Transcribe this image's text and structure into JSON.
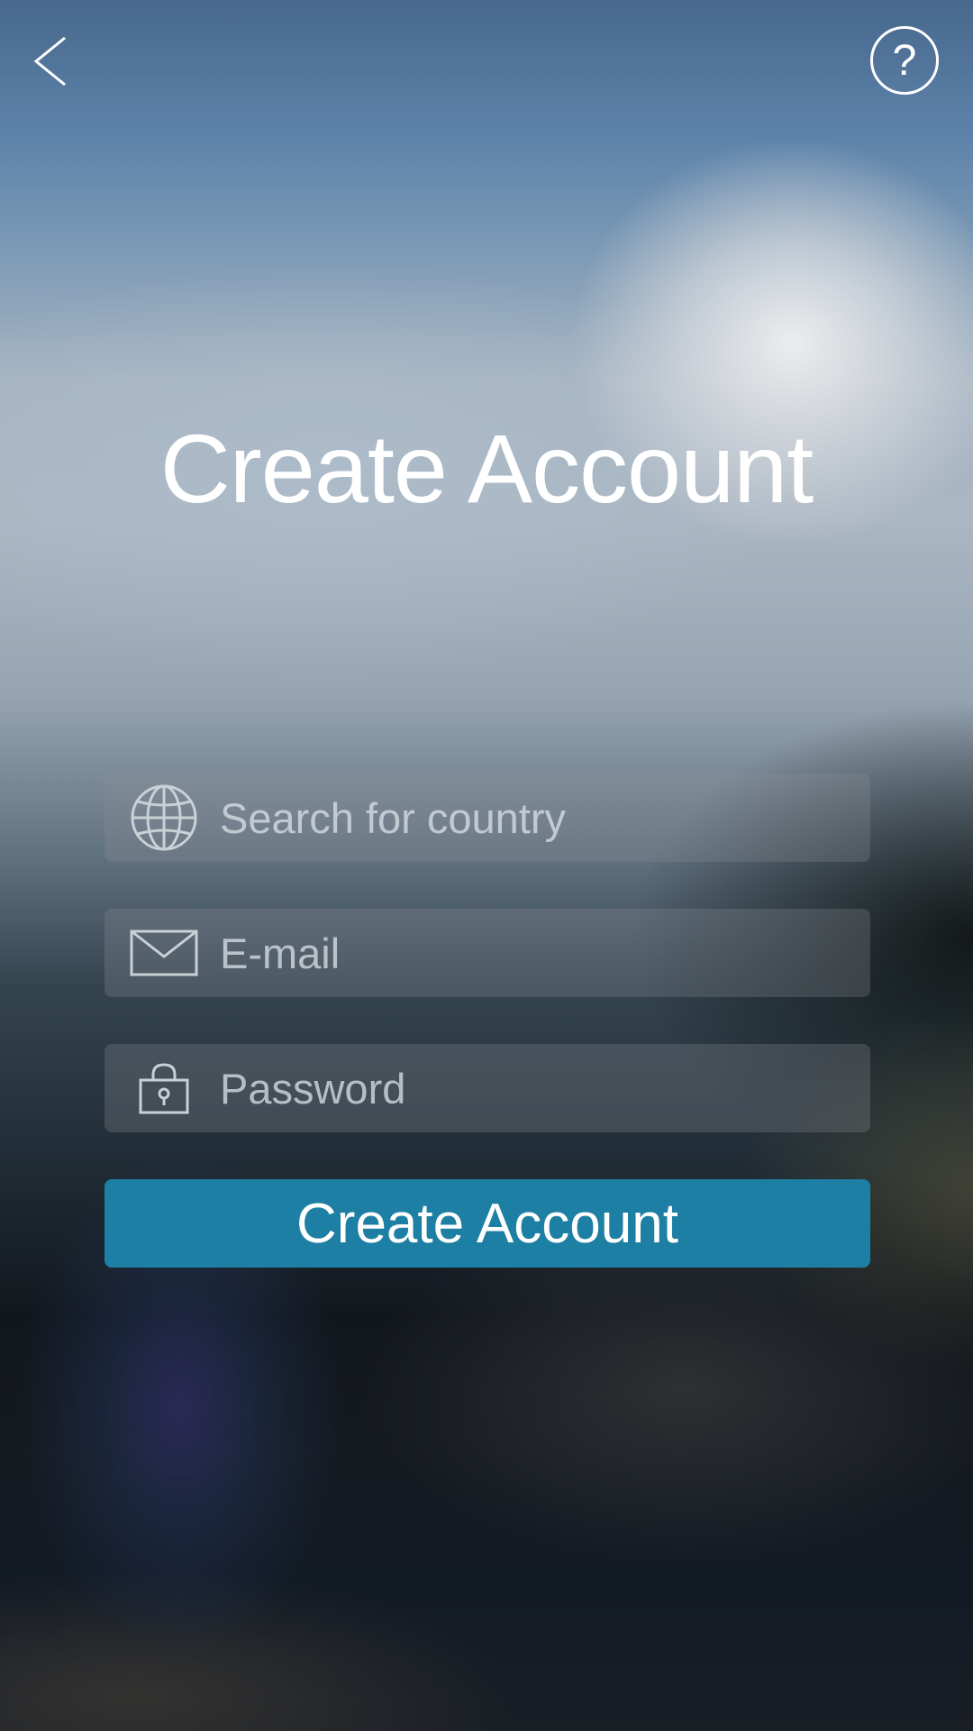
{
  "header": {
    "back_icon": "chevron-left-icon",
    "help_icon": "question-mark-icon",
    "help_label": "?"
  },
  "title": "Create Account",
  "form": {
    "country": {
      "icon": "globe-icon",
      "placeholder": "Search for country",
      "value": ""
    },
    "email": {
      "icon": "envelope-icon",
      "placeholder": "E-mail",
      "value": ""
    },
    "password": {
      "icon": "lock-icon",
      "placeholder": "Password",
      "value": ""
    },
    "submit_label": "Create Account"
  },
  "colors": {
    "accent": "#1d7fa3",
    "text": "#ffffff",
    "placeholder": "#d7dee4"
  }
}
